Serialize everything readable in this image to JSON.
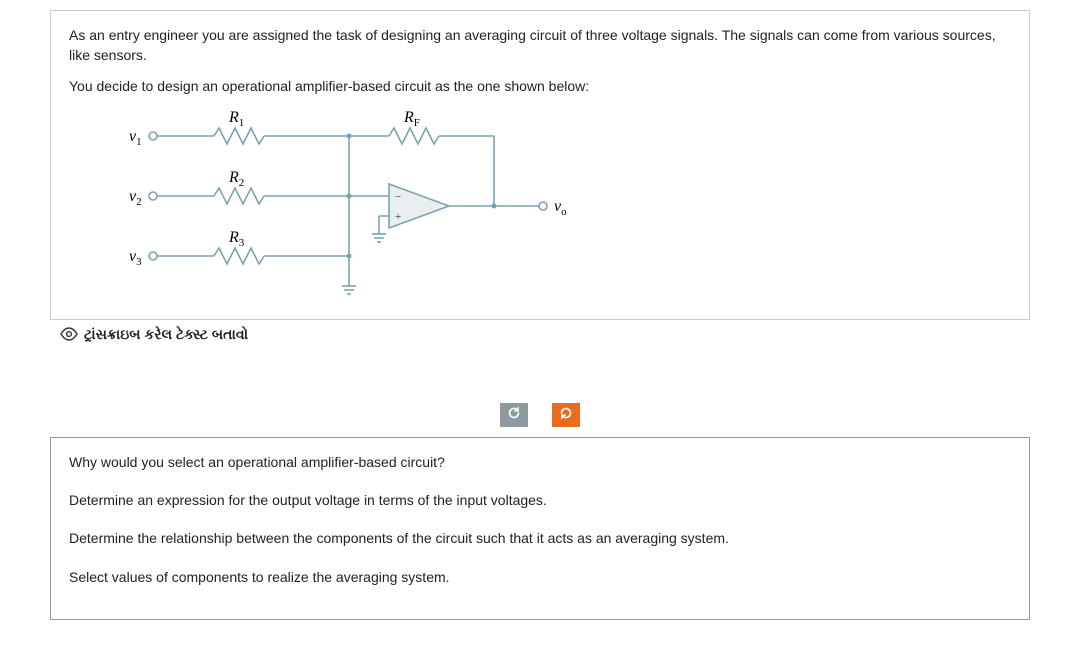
{
  "problem": {
    "intro1": "As an entry engineer you are assigned the task of designing an averaging circuit of three voltage signals. The signals can come from various sources, like sensors.",
    "intro2": "You decide to design an operational amplifier-based circuit as the one shown below:"
  },
  "circuit": {
    "v1": "v",
    "v1_sub": "1",
    "v2": "v",
    "v2_sub": "2",
    "v3": "v",
    "v3_sub": "3",
    "R1": "R",
    "R1_sub": "1",
    "R2": "R",
    "R2_sub": "2",
    "R3": "R",
    "R3_sub": "3",
    "RF": "R",
    "RF_sub": "F",
    "vo": "v",
    "vo_sub": "o",
    "minus": "−",
    "plus": "+"
  },
  "transcribe_label": "ટ્રાંસક્રાઇબ કરેલ ટેક્સ્ટ બતાવો",
  "questions": {
    "q1": "Why would you select an operational amplifier-based circuit?",
    "q2": "Determine an expression for the output voltage in terms of the input voltages.",
    "q3": "Determine the relationship between the components of the circuit such that it acts as an averaging system.",
    "q4": "Select values of components to realize the averaging system."
  }
}
